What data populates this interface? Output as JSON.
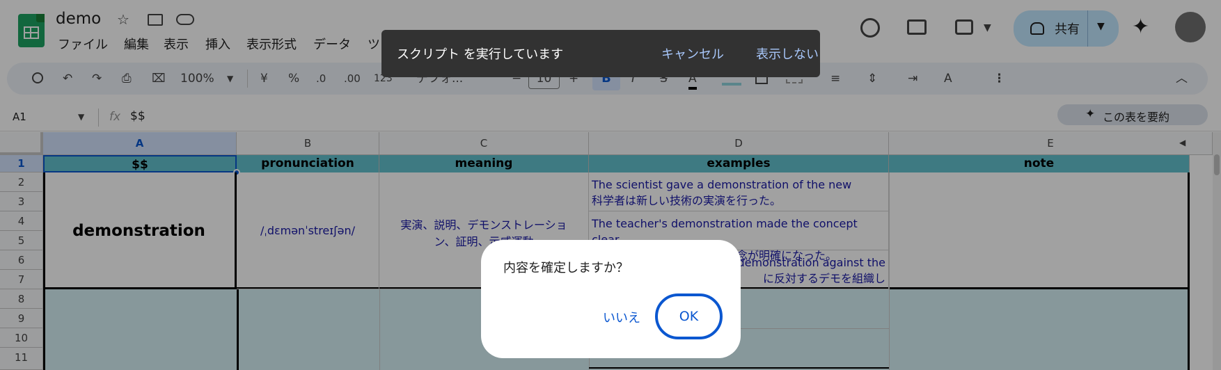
{
  "doc": {
    "title": "demo"
  },
  "menu": [
    "ファイル",
    "編集",
    "表示",
    "挿入",
    "表示形式",
    "データ",
    "ツ"
  ],
  "header": {
    "share_label": "共有"
  },
  "toolbar": {
    "zoom": "100%",
    "currency": "¥",
    "percent": "%",
    "dec_decrease": ".0",
    "dec_increase": ".00",
    "number_format": "123",
    "font": "デフォ...",
    "font_size": "10",
    "bold": "B",
    "italic": "I",
    "strike": "S",
    "text_color": "A"
  },
  "formula_bar": {
    "cell_ref": "A1",
    "fx": "fx",
    "content": "$$",
    "summarize_label": "この表を要約"
  },
  "columns": [
    "A",
    "B",
    "C",
    "D",
    "E"
  ],
  "rows": [
    "1",
    "2",
    "3",
    "4",
    "5",
    "6",
    "7",
    "8",
    "9",
    "10",
    "11"
  ],
  "header_row": [
    "$$",
    "pronunciation",
    "meaning",
    "examples",
    "note"
  ],
  "entry": {
    "word": "demonstration",
    "pronunciation": "/ˌdɛmənˈstreɪʃən/",
    "meaning": "実演、説明、デモンストレーション、証明、示威運動",
    "meaning_line1": "実演、説明、デモンストレーショ",
    "meaning_line2": "ン、証明、示威運動",
    "examples": [
      "The scientist gave a demonstration of the new",
      "科学者は新しい技術の実演を行った。",
      "The teacher's demonstration made the concept clear.",
      "先生の説明のおかげでその概念が明確になった。",
      "demonstration against the",
      "に反対するデモを組織し"
    ]
  },
  "snackbar": {
    "message": "スクリプト を実行しています",
    "cancel_label": "キャンセル",
    "dismiss_label": "表示しない"
  },
  "dialog": {
    "question": "内容を確定しますか？",
    "no_label": "いいえ",
    "ok_label": "OK"
  },
  "colors": {
    "header_fill": "#63c1ce",
    "link_blue": "#0b57d0",
    "sheets_green": "#1ea362"
  }
}
